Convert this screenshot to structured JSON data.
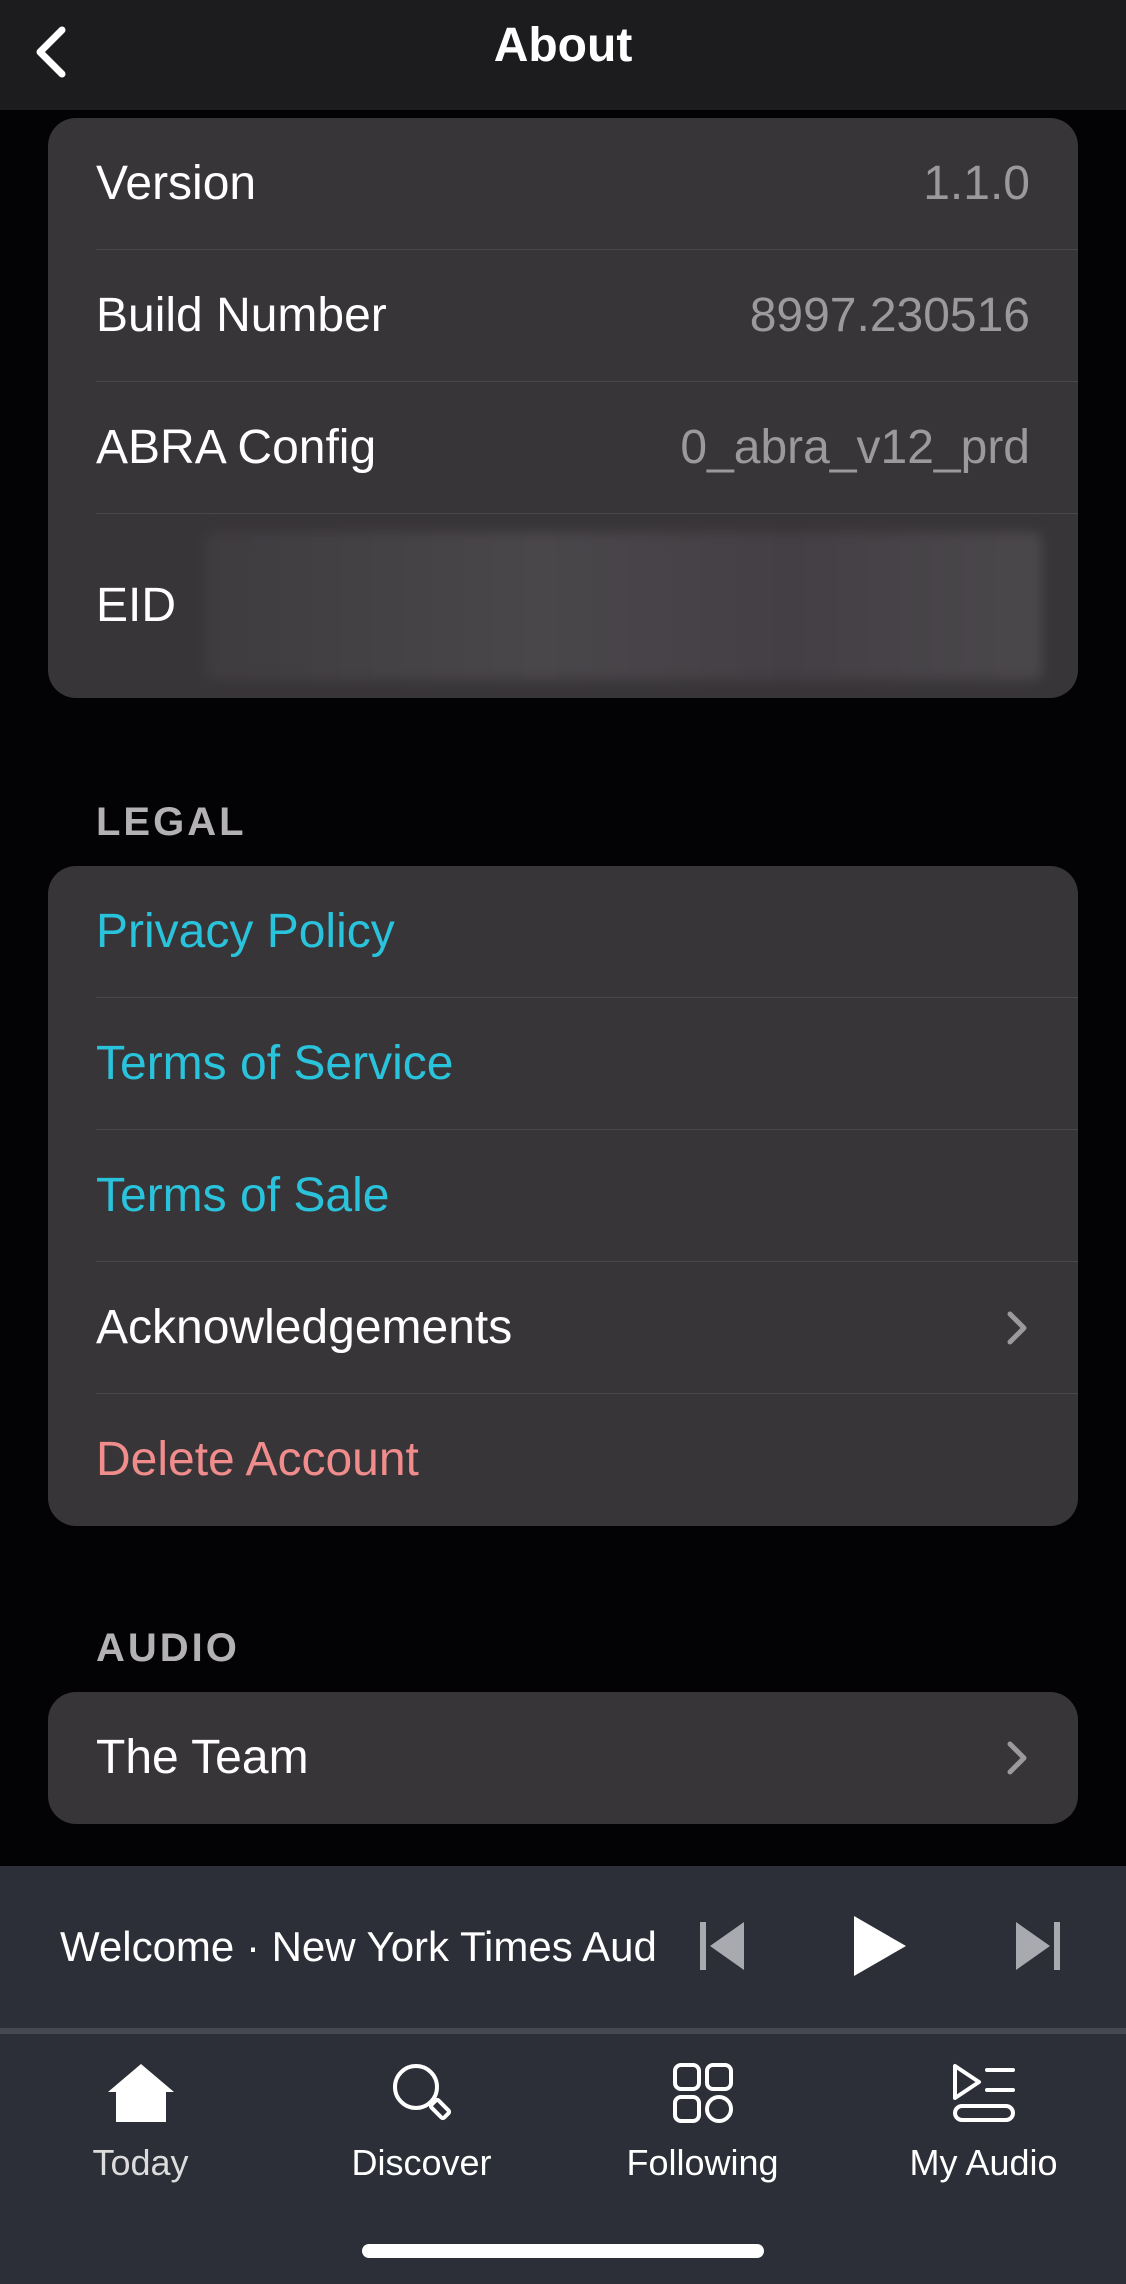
{
  "header": {
    "title": "About"
  },
  "info": {
    "rows": [
      {
        "label": "Version",
        "value": "1.1.0"
      },
      {
        "label": "Build Number",
        "value": "8997.230516"
      },
      {
        "label": "ABRA Config",
        "value": "0_abra_v12_prd"
      }
    ],
    "eid_label": "EID"
  },
  "legal": {
    "header": "LEGAL",
    "privacy_policy": "Privacy Policy",
    "terms_of_service": "Terms of Service",
    "terms_of_sale": "Terms of Sale",
    "acknowledgements": "Acknowledgements",
    "delete_account": "Delete Account"
  },
  "audio": {
    "header": "AUDIO",
    "the_team": "The Team"
  },
  "mini_player": {
    "now_playing": "Welcome · New York Times Audio"
  },
  "tabs": [
    {
      "label": "Today",
      "icon": "home-icon"
    },
    {
      "label": "Discover",
      "icon": "search-icon"
    },
    {
      "label": "Following",
      "icon": "grid-icon"
    },
    {
      "label": "My Audio",
      "icon": "playlist-icon"
    }
  ],
  "colors": {
    "background": "#030204",
    "card": "#383538",
    "link": "#2ac3dc",
    "danger": "#f08c8c",
    "secondary_text": "#9c999d",
    "player_bar": "#2d2f38"
  }
}
